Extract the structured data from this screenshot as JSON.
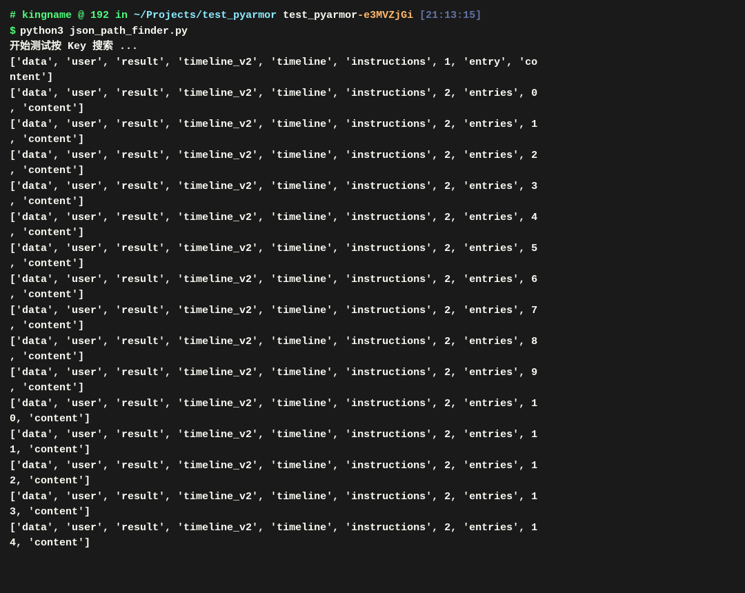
{
  "terminal": {
    "prompt": {
      "hash": "#",
      "username": "kingname",
      "at": "@",
      "ip": "192",
      "in": "in",
      "path": "~/Projects/test_pyarmor",
      "branch_prefix": "test_pyarmor",
      "git_branch": "e3MVZjGi",
      "timestamp": "[21:13:15]"
    },
    "command_line": {
      "dollar": "$",
      "command": "python3 json_path_finder.py"
    },
    "status_text": "开始测试按 Key 搜索 ...",
    "output_lines": [
      "['data', 'user', 'result', 'timeline_v2', 'timeline', 'instructions', 1, 'entry', 'content']",
      "['data', 'user', 'result', 'timeline_v2', 'timeline', 'instructions', 2, 'entries', 0, 'content']",
      "['data', 'user', 'result', 'timeline_v2', 'timeline', 'instructions', 2, 'entries', 1, 'content']",
      "['data', 'user', 'result', 'timeline_v2', 'timeline', 'instructions', 2, 'entries', 2, 'content']",
      "['data', 'user', 'result', 'timeline_v2', 'timeline', 'instructions', 2, 'entries', 3, 'content']",
      "['data', 'user', 'result', 'timeline_v2', 'timeline', 'instructions', 2, 'entries', 4, 'content']",
      "['data', 'user', 'result', 'timeline_v2', 'timeline', 'instructions', 2, 'entries', 5, 'content']",
      "['data', 'user', 'result', 'timeline_v2', 'timeline', 'instructions', 2, 'entries', 6, 'content']",
      "['data', 'user', 'result', 'timeline_v2', 'timeline', 'instructions', 2, 'entries', 7, 'content']",
      "['data', 'user', 'result', 'timeline_v2', 'timeline', 'instructions', 2, 'entries', 8, 'content']",
      "['data', 'user', 'result', 'timeline_v2', 'timeline', 'instructions', 2, 'entries', 9, 'content']",
      "['data', 'user', 'result', 'timeline_v2', 'timeline', 'instructions', 2, 'entries', 10, 'content']",
      "['data', 'user', 'result', 'timeline_v2', 'timeline', 'instructions', 2, 'entries', 11, 'content']",
      "['data', 'user', 'result', 'timeline_v2', 'timeline', 'instructions', 2, 'entries', 12, 'content']",
      "['data', 'user', 'result', 'timeline_v2', 'timeline', 'instructions', 2, 'entries', 13, 'content']",
      "['data', 'user', 'result', 'timeline_v2', 'timeline', 'instructions', 2, 'entries', 14, 'content']"
    ]
  }
}
